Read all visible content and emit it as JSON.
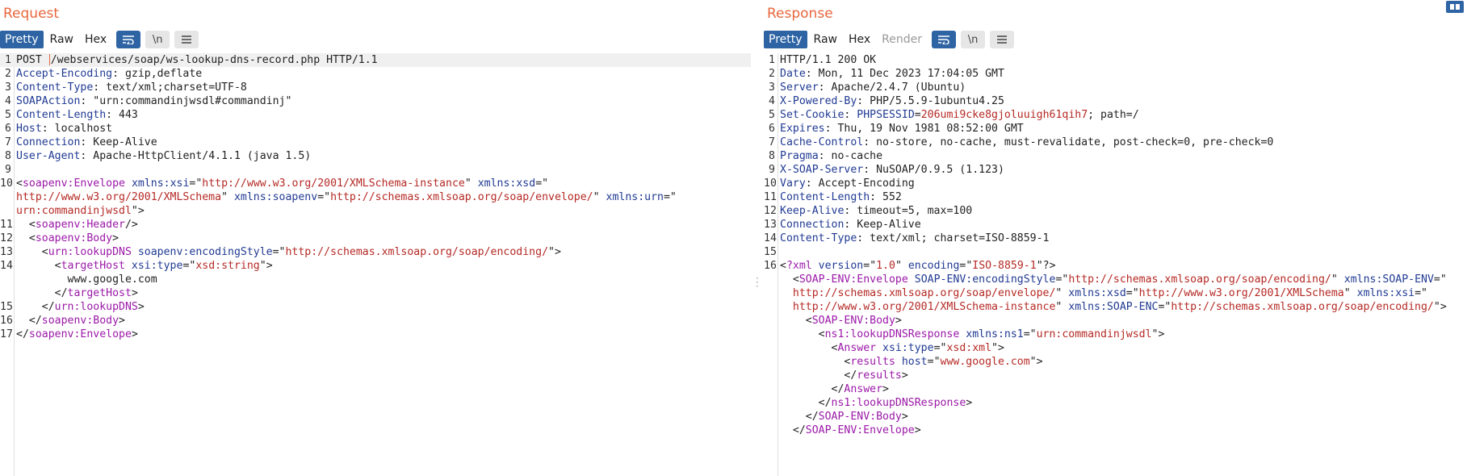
{
  "request": {
    "title": "Request",
    "tabs": [
      "Pretty",
      "Raw",
      "Hex"
    ],
    "newline_toggle": "\\n",
    "lines": [
      {
        "n": "1",
        "cursor": true,
        "parts": [
          [
            "",
            "POST "
          ],
          [
            "cursor",
            ""
          ],
          [
            "",
            "/webservices/soap/ws-lookup-dns-record.php HTTP/1.1"
          ]
        ]
      },
      {
        "n": "2",
        "parts": [
          [
            "k",
            "Accept-Encoding"
          ],
          [
            "",
            ": gzip,deflate"
          ]
        ]
      },
      {
        "n": "3",
        "parts": [
          [
            "k",
            "Content-Type"
          ],
          [
            "",
            ": text/xml;charset=UTF-8"
          ]
        ]
      },
      {
        "n": "4",
        "parts": [
          [
            "k",
            "SOAPAction"
          ],
          [
            "",
            ": \"urn:commandinjwsdl#commandinj\""
          ]
        ]
      },
      {
        "n": "5",
        "parts": [
          [
            "k",
            "Content-Length"
          ],
          [
            "",
            ": 443"
          ]
        ]
      },
      {
        "n": "6",
        "parts": [
          [
            "k",
            "Host"
          ],
          [
            "",
            ": localhost"
          ]
        ]
      },
      {
        "n": "7",
        "parts": [
          [
            "k",
            "Connection"
          ],
          [
            "",
            ": Keep-Alive"
          ]
        ]
      },
      {
        "n": "8",
        "parts": [
          [
            "k",
            "User-Agent"
          ],
          [
            "",
            ": Apache-HttpClient/4.1.1 (java 1.5)"
          ]
        ]
      },
      {
        "n": "9",
        "parts": []
      },
      {
        "n": "10",
        "parts": [
          [
            "",
            "<"
          ],
          [
            "t",
            "soapenv:Envelope"
          ],
          [
            "",
            ""
          ],
          [
            "a",
            " xmlns:xsi"
          ],
          [
            "",
            "=\""
          ],
          [
            "s",
            "http://www.w3.org/2001/XMLSchema-instance"
          ],
          [
            "",
            "\""
          ],
          [
            "a",
            " xmlns:xsd"
          ],
          [
            "",
            "=\""
          ]
        ]
      },
      {
        "n": "",
        "parts": [
          [
            "s",
            "http://www.w3.org/2001/XMLSchema"
          ],
          [
            "",
            "\""
          ],
          [
            "a",
            " xmlns:soapenv"
          ],
          [
            "",
            "=\""
          ],
          [
            "s",
            "http://schemas.xmlsoap.org/soap/envelope/"
          ],
          [
            "",
            "\""
          ],
          [
            "a",
            " xmlns:urn"
          ],
          [
            "",
            "=\""
          ]
        ]
      },
      {
        "n": "",
        "parts": [
          [
            "s",
            "urn:commandinjwsdl"
          ],
          [
            "",
            "\">"
          ]
        ]
      },
      {
        "n": "11",
        "parts": [
          [
            "",
            "  <"
          ],
          [
            "t",
            "soapenv:Header"
          ],
          [
            "",
            "/>"
          ]
        ]
      },
      {
        "n": "12",
        "parts": [
          [
            "",
            "  <"
          ],
          [
            "t",
            "soapenv:Body"
          ],
          [
            "",
            ">"
          ]
        ]
      },
      {
        "n": "13",
        "parts": [
          [
            "",
            "    <"
          ],
          [
            "t",
            "urn:lookupDNS"
          ],
          [
            "a",
            " soapenv:encodingStyle"
          ],
          [
            "",
            "=\""
          ],
          [
            "s",
            "http://schemas.xmlsoap.org/soap/encoding/"
          ],
          [
            "",
            "\">"
          ]
        ]
      },
      {
        "n": "14",
        "parts": [
          [
            "",
            "      <"
          ],
          [
            "t",
            "targetHost"
          ],
          [
            "a",
            " xsi:type"
          ],
          [
            "",
            "=\""
          ],
          [
            "s",
            "xsd:string"
          ],
          [
            "",
            "\">"
          ]
        ]
      },
      {
        "n": "",
        "parts": [
          [
            "",
            "        www.google.com"
          ]
        ]
      },
      {
        "n": "",
        "parts": [
          [
            "",
            "      </"
          ],
          [
            "t",
            "targetHost"
          ],
          [
            "",
            ">"
          ]
        ]
      },
      {
        "n": "15",
        "parts": [
          [
            "",
            "    </"
          ],
          [
            "t",
            "urn:lookupDNS"
          ],
          [
            "",
            ">"
          ]
        ]
      },
      {
        "n": "16",
        "parts": [
          [
            "",
            "  </"
          ],
          [
            "t",
            "soapenv:Body"
          ],
          [
            "",
            ">"
          ]
        ]
      },
      {
        "n": "17",
        "parts": [
          [
            "",
            "</"
          ],
          [
            "t",
            "soapenv:Envelope"
          ],
          [
            "",
            ">"
          ]
        ]
      }
    ]
  },
  "response": {
    "title": "Response",
    "tabs": [
      "Pretty",
      "Raw",
      "Hex",
      "Render"
    ],
    "newline_toggle": "\\n",
    "lines": [
      {
        "n": "1",
        "parts": [
          [
            "",
            "HTTP/1.1 200 OK"
          ]
        ]
      },
      {
        "n": "2",
        "parts": [
          [
            "k",
            "Date"
          ],
          [
            "",
            ": Mon, 11 Dec 2023 17:04:05 GMT"
          ]
        ]
      },
      {
        "n": "3",
        "parts": [
          [
            "k",
            "Server"
          ],
          [
            "",
            ": Apache/2.4.7 (Ubuntu)"
          ]
        ]
      },
      {
        "n": "4",
        "parts": [
          [
            "k",
            "X-Powered-By"
          ],
          [
            "",
            ": PHP/5.5.9-1ubuntu4.25"
          ]
        ]
      },
      {
        "n": "5",
        "parts": [
          [
            "k",
            "Set-Cookie"
          ],
          [
            "",
            ": "
          ],
          [
            "k",
            "PHPSESSID"
          ],
          [
            "",
            "="
          ],
          [
            "s",
            "206umi9cke8gjoluuigh61qih7"
          ],
          [
            "",
            "; path=/"
          ]
        ]
      },
      {
        "n": "6",
        "parts": [
          [
            "k",
            "Expires"
          ],
          [
            "",
            ": Thu, 19 Nov 1981 08:52:00 GMT"
          ]
        ]
      },
      {
        "n": "7",
        "parts": [
          [
            "k",
            "Cache-Control"
          ],
          [
            "",
            ": no-store, no-cache, must-revalidate, post-check=0, pre-check=0"
          ]
        ]
      },
      {
        "n": "8",
        "parts": [
          [
            "k",
            "Pragma"
          ],
          [
            "",
            ": no-cache"
          ]
        ]
      },
      {
        "n": "9",
        "parts": [
          [
            "k",
            "X-SOAP-Server"
          ],
          [
            "",
            ": NuSOAP/0.9.5 (1.123)"
          ]
        ]
      },
      {
        "n": "10",
        "parts": [
          [
            "k",
            "Vary"
          ],
          [
            "",
            ": Accept-Encoding"
          ]
        ]
      },
      {
        "n": "11",
        "parts": [
          [
            "k",
            "Content-Length"
          ],
          [
            "",
            ": 552"
          ]
        ]
      },
      {
        "n": "12",
        "parts": [
          [
            "k",
            "Keep-Alive"
          ],
          [
            "",
            ": timeout=5, max=100"
          ]
        ]
      },
      {
        "n": "13",
        "parts": [
          [
            "k",
            "Connection"
          ],
          [
            "",
            ": Keep-Alive"
          ]
        ]
      },
      {
        "n": "14",
        "parts": [
          [
            "k",
            "Content-Type"
          ],
          [
            "",
            ": text/xml; charset=ISO-8859-1"
          ]
        ]
      },
      {
        "n": "15",
        "parts": []
      },
      {
        "n": "16",
        "parts": [
          [
            "",
            "<"
          ],
          [
            "t",
            "?xml"
          ],
          [
            "a",
            " version"
          ],
          [
            "",
            "=\""
          ],
          [
            "s",
            "1.0"
          ],
          [
            "",
            "\""
          ],
          [
            "a",
            " encoding"
          ],
          [
            "",
            "=\""
          ],
          [
            "s",
            "ISO-8859-1"
          ],
          [
            "",
            "\"?>"
          ]
        ]
      },
      {
        "n": "",
        "parts": [
          [
            "",
            "  <"
          ],
          [
            "t",
            "SOAP-ENV:Envelope"
          ],
          [
            "a",
            " SOAP-ENV:encodingStyle"
          ],
          [
            "",
            "=\""
          ],
          [
            "s",
            "http://schemas.xmlsoap.org/soap/encoding/"
          ],
          [
            "",
            "\""
          ],
          [
            "a",
            " xmlns:SOAP-ENV"
          ],
          [
            "",
            "=\""
          ]
        ]
      },
      {
        "n": "",
        "parts": [
          [
            "s",
            "  http://schemas.xmlsoap.org/soap/envelope/"
          ],
          [
            "",
            "\""
          ],
          [
            "a",
            " xmlns:xsd"
          ],
          [
            "",
            "=\""
          ],
          [
            "s",
            "http://www.w3.org/2001/XMLSchema"
          ],
          [
            "",
            "\""
          ],
          [
            "a",
            " xmlns:xsi"
          ],
          [
            "",
            "=\""
          ]
        ]
      },
      {
        "n": "",
        "parts": [
          [
            "s",
            "  http://www.w3.org/2001/XMLSchema-instance"
          ],
          [
            "",
            "\""
          ],
          [
            "a",
            " xmlns:SOAP-ENC"
          ],
          [
            "",
            "=\""
          ],
          [
            "s",
            "http://schemas.xmlsoap.org/soap/encoding/"
          ],
          [
            "",
            "\">"
          ]
        ]
      },
      {
        "n": "",
        "parts": [
          [
            "",
            "    <"
          ],
          [
            "t",
            "SOAP-ENV:Body"
          ],
          [
            "",
            ">"
          ]
        ]
      },
      {
        "n": "",
        "parts": [
          [
            "",
            "      <"
          ],
          [
            "t",
            "ns1:lookupDNSResponse"
          ],
          [
            "a",
            " xmlns:ns1"
          ],
          [
            "",
            "=\""
          ],
          [
            "s",
            "urn:commandinjwsdl"
          ],
          [
            "",
            "\">"
          ]
        ]
      },
      {
        "n": "",
        "parts": [
          [
            "",
            "        <"
          ],
          [
            "t",
            "Answer"
          ],
          [
            "a",
            " xsi:type"
          ],
          [
            "",
            "=\""
          ],
          [
            "s",
            "xsd:xml"
          ],
          [
            "",
            "\">"
          ]
        ]
      },
      {
        "n": "",
        "parts": [
          [
            "",
            "          <"
          ],
          [
            "t",
            "results"
          ],
          [
            "a",
            " host"
          ],
          [
            "",
            "=\""
          ],
          [
            "s",
            "www.google.com"
          ],
          [
            "",
            "\">"
          ]
        ]
      },
      {
        "n": "",
        "parts": [
          [
            "",
            "          </"
          ],
          [
            "t",
            "results"
          ],
          [
            "",
            ">"
          ]
        ]
      },
      {
        "n": "",
        "parts": [
          [
            "",
            "        </"
          ],
          [
            "t",
            "Answer"
          ],
          [
            "",
            ">"
          ]
        ]
      },
      {
        "n": "",
        "parts": [
          [
            "",
            "      </"
          ],
          [
            "t",
            "ns1:lookupDNSResponse"
          ],
          [
            "",
            ">"
          ]
        ]
      },
      {
        "n": "",
        "parts": [
          [
            "",
            "    </"
          ],
          [
            "t",
            "SOAP-ENV:Body"
          ],
          [
            "",
            ">"
          ]
        ]
      },
      {
        "n": "",
        "parts": [
          [
            "",
            "  </"
          ],
          [
            "t",
            "SOAP-ENV:Envelope"
          ],
          [
            "",
            ">"
          ]
        ]
      }
    ]
  },
  "icons": {
    "wrap": "word-wrap-icon",
    "menu": "menu-icon",
    "layout": "layout-toggle-icon"
  },
  "colors": {
    "accent": "#2e64a4",
    "title": "#e8663d",
    "header_name": "#203a93",
    "xml_tag": "#9b19a8",
    "string": "#b52a25"
  }
}
